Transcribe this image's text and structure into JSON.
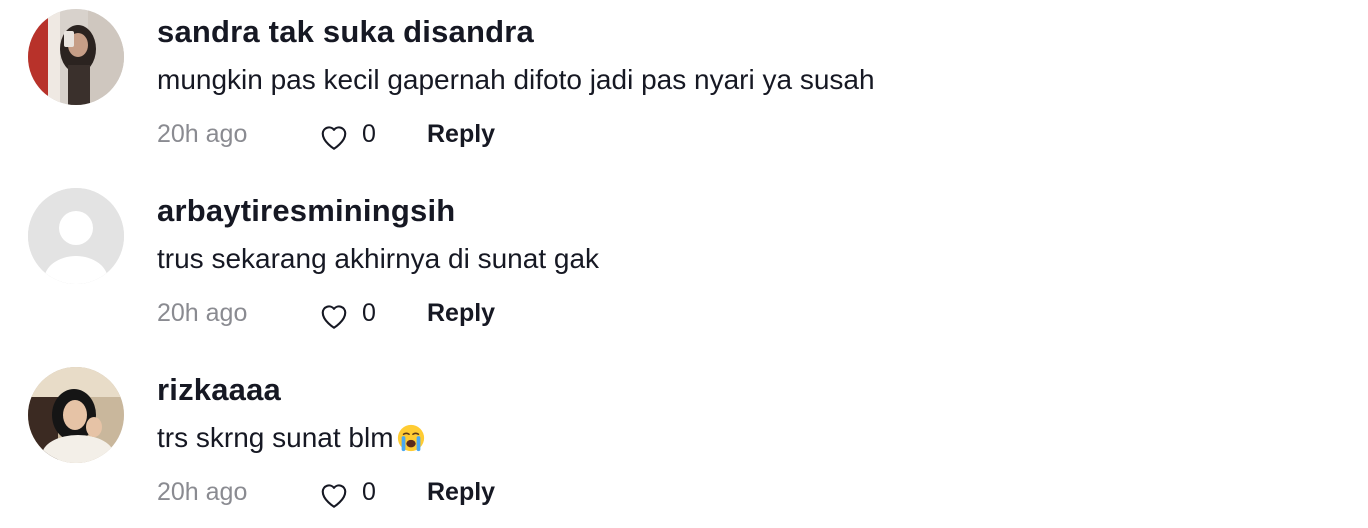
{
  "comments": [
    {
      "username": "sandra tak suka disandra",
      "text": "mungkin pas kecil gapernah difoto jadi pas nyari ya susah",
      "time": "20h ago",
      "likes": "0",
      "reply_label": "Reply",
      "avatar": "photo"
    },
    {
      "username": "arbaytiresminingsih",
      "text": "trus sekarang akhirnya di sunat gak",
      "time": "20h ago",
      "likes": "0",
      "reply_label": "Reply",
      "avatar": "default"
    },
    {
      "username": "rizkaaaa",
      "text": "trs skrng sunat blm",
      "emoji": "loudly-crying-face",
      "time": "20h ago",
      "likes": "0",
      "reply_label": "Reply",
      "avatar": "photo"
    }
  ],
  "icons": {
    "like": "heart-outline-icon"
  },
  "colors": {
    "text": "#161823",
    "muted": "#8a8b91",
    "icon": "#161823"
  }
}
